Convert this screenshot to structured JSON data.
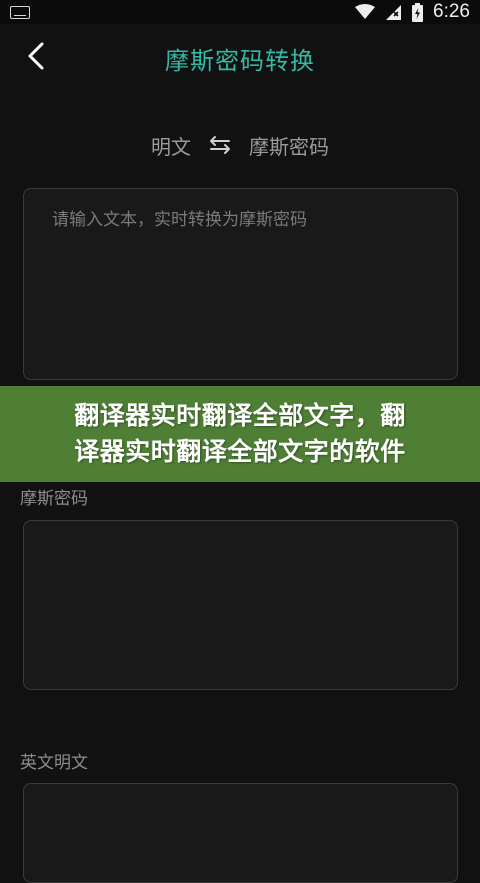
{
  "status_bar": {
    "time": "6:26"
  },
  "header": {
    "title": "摩斯密码转换"
  },
  "lang_switch": {
    "source": "明文",
    "target": "摩斯密码"
  },
  "input": {
    "placeholder": "请输入文本，实时转换为摩斯密码"
  },
  "overlay_banner": {
    "line1": "翻译器实时翻译全部文字，翻",
    "line2": "译器实时翻译全部文字的软件"
  },
  "morse_section": {
    "label": "摩斯密码"
  },
  "english_section": {
    "label": "英文明文"
  },
  "colors": {
    "accent": "#34b9a5",
    "banner": "#4f7f35",
    "background": "#111111"
  }
}
